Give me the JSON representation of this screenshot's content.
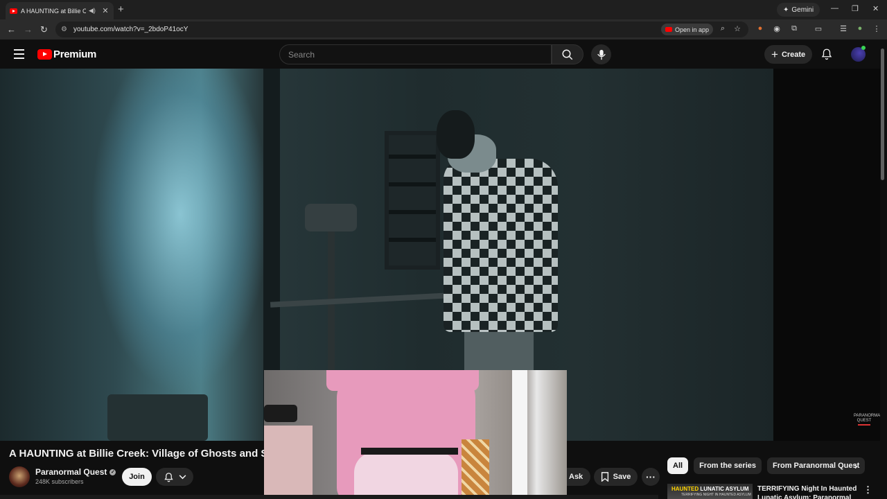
{
  "browser": {
    "tab_title": "A HAUNTING at Billie Creek",
    "new_tab": "+",
    "gemini_label": "Gemini",
    "url": "youtube.com/watch?v=_2bdoP41ocY",
    "open_in_app": "Open in app"
  },
  "masthead": {
    "logo_text": "Premium",
    "search_placeholder": "Search",
    "create_label": "Create"
  },
  "video": {
    "watermark": "PARANORMAL QUEST",
    "title": "A HAUNTING at Billie Creek: Village of Ghosts and Spirits"
  },
  "channel": {
    "name": "Paranormal Quest",
    "subscribers": "248K subscribers",
    "join_label": "Join"
  },
  "actions": {
    "ask_label": "Ask",
    "save_label": "Save"
  },
  "chips": [
    "All",
    "From the series",
    "From Paranormal Quest"
  ],
  "recommended": {
    "thumb_label_yellow": "HAUNTED",
    "thumb_label_white": "LUNATIC ASYLUM",
    "thumb_sub": "TERRIFYING NIGHT IN HAUNTED ASYLUM",
    "title": "TERRIFYING Night In Haunted Lunatic Asylum: Paranormal"
  },
  "colors": {
    "brand_red": "#ff0000",
    "background": "#0f0f0f",
    "chip_active": "#f1f1f1"
  }
}
